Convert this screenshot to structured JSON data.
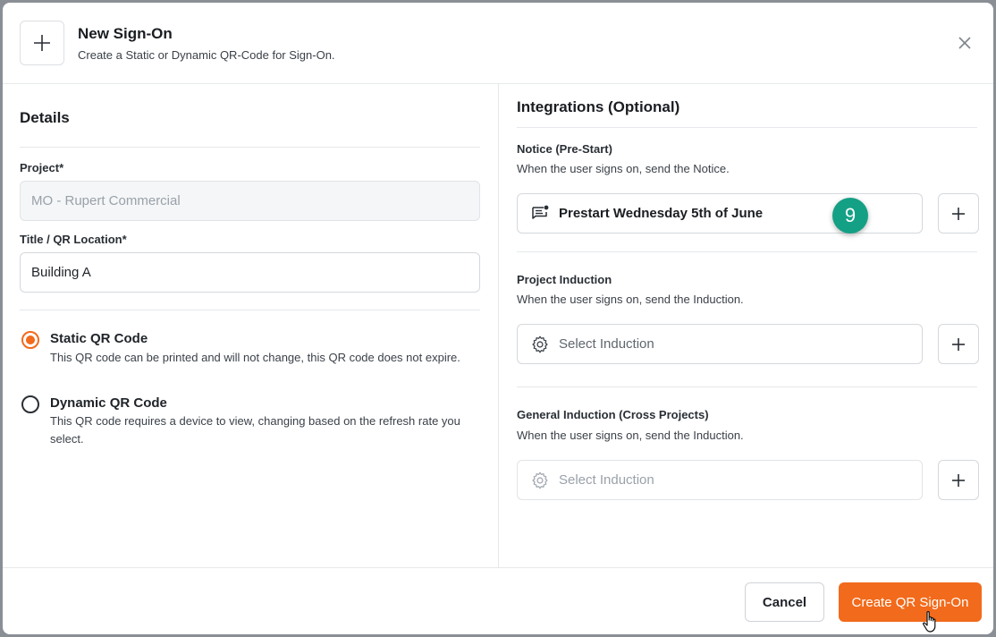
{
  "header": {
    "title": "New Sign-On",
    "subtitle": "Create a Static or Dynamic QR-Code for Sign-On.",
    "icon": "plus-icon",
    "close_icon": "close-icon"
  },
  "details": {
    "title": "Details",
    "project_label": "Project*",
    "project_value": "MO - Rupert Commercial",
    "location_label": "Title / QR Location*",
    "location_value": "Building A",
    "qr_options": [
      {
        "label": "Static QR Code",
        "description": "This QR code can be printed and will not change, this QR code does not expire.",
        "checked": true
      },
      {
        "label": "Dynamic QR Code",
        "description": "This QR code requires a device to view, changing based on the refresh rate you select.",
        "checked": false
      }
    ]
  },
  "integrations": {
    "title": "Integrations (Optional)",
    "notice": {
      "label": "Notice (Pre-Start)",
      "hint": "When the user signs on, send the Notice.",
      "value": "Prestart Wednesday 5th of June",
      "icon": "notice-icon"
    },
    "project_induction": {
      "label": "Project Induction",
      "hint": "When the user signs on, send the Induction.",
      "placeholder": "Select Induction",
      "icon": "gear-icon"
    },
    "general_induction": {
      "label": "General Induction (Cross Projects)",
      "hint": "When the user signs on, send the Induction.",
      "placeholder": "Select Induction",
      "icon": "gear-icon"
    }
  },
  "step_badge": "9",
  "footer": {
    "cancel_label": "Cancel",
    "create_label": "Create QR Sign-On"
  },
  "colors": {
    "accent": "#f26a1b",
    "badge": "#14a085"
  }
}
